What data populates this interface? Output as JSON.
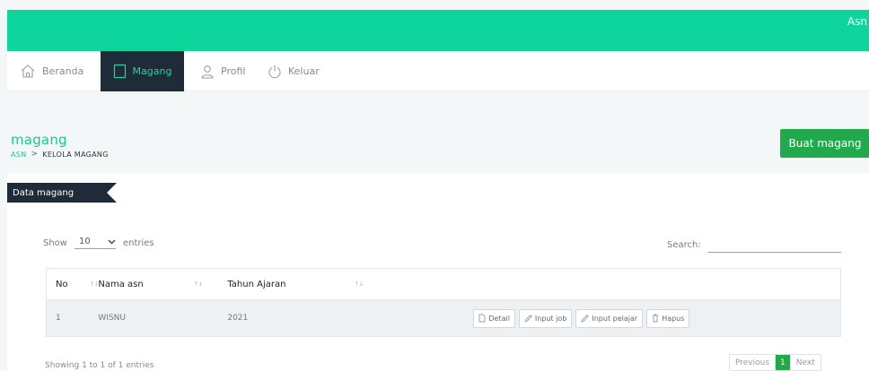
{
  "topbar": {
    "user": "Asn",
    "color": "#0dd59c"
  },
  "nav": {
    "items": [
      {
        "label": "Beranda",
        "icon": "home-icon"
      },
      {
        "label": "Magang",
        "icon": "book-icon",
        "active": true
      },
      {
        "label": "Profil",
        "icon": "user-icon"
      },
      {
        "label": "Keluar",
        "icon": "power-icon"
      }
    ]
  },
  "header": {
    "title": "magang",
    "breadcrumb": {
      "root": "ASN",
      "separator": ">",
      "current": "KELOLA MAGANG"
    },
    "create_button": "Buat magang"
  },
  "card": {
    "tab_label": "Data magang",
    "length": {
      "show": "Show",
      "value": "10",
      "entries": "entries"
    },
    "search_label": "Search:",
    "search_value": "",
    "columns": [
      "No",
      "Nama asn",
      "Tahun Ajaran"
    ],
    "rows": [
      {
        "no": "1",
        "nama": "WISNU",
        "tahun": "2021"
      }
    ],
    "actions": [
      "Detail",
      "Input job",
      "Input pelajar",
      "Hapus"
    ],
    "info": "Showing 1 to 1 of 1 entries",
    "pagination": {
      "previous": "Previous",
      "current": "1",
      "next": "Next"
    }
  },
  "colors": {
    "accent": "#0dd59c",
    "dark": "#1f2b38",
    "green_button": "#21a94c",
    "title_green": "#1bc88f"
  }
}
